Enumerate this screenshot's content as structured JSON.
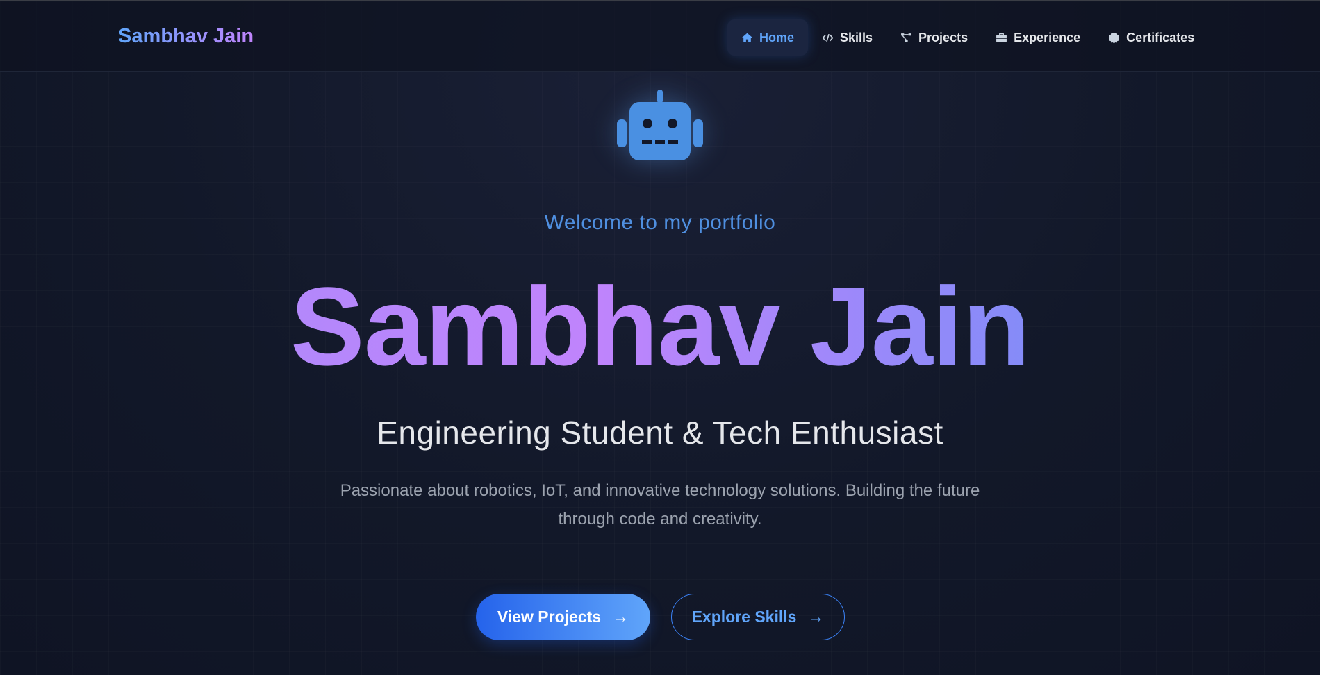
{
  "nav": {
    "brand": "Sambhav Jain",
    "items": [
      {
        "label": "Home",
        "icon": "home-icon",
        "active": true
      },
      {
        "label": "Skills",
        "icon": "code-icon",
        "active": false
      },
      {
        "label": "Projects",
        "icon": "project-diagram-icon",
        "active": false
      },
      {
        "label": "Experience",
        "icon": "briefcase-icon",
        "active": false
      },
      {
        "label": "Certificates",
        "icon": "certificate-icon",
        "active": false
      }
    ]
  },
  "hero": {
    "icon": "robot-icon",
    "welcome": "Welcome to my portfolio",
    "name": "Sambhav Jain",
    "tagline": "Engineering Student & Tech Enthusiast",
    "description": "Passionate about robotics, IoT, and innovative technology solutions. Building the future through code and creativity.",
    "primary_button": "View Projects",
    "secondary_button": "Explore Skills",
    "arrow": "→"
  },
  "colors": {
    "background": "#0f1525",
    "accent_blue": "#60a5fa",
    "accent_purple": "#c084fc",
    "primary_button": "#2563eb"
  }
}
